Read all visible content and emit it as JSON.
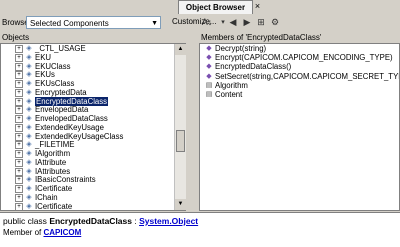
{
  "tab": {
    "title": "Object Browser",
    "close_glyph": "×"
  },
  "toolbar": {
    "browse_label": "Browse:",
    "browse_value": "Selected Components",
    "customize_label": "Customize...",
    "icons": [
      "sort-icon",
      "back-icon",
      "forward-icon",
      "add-reference-icon",
      "settings-icon"
    ]
  },
  "left_pane": {
    "header": "Objects",
    "items": [
      {
        "label": "_CTL_USAGE"
      },
      {
        "label": "EKU"
      },
      {
        "label": "EKUClass"
      },
      {
        "label": "EKUs"
      },
      {
        "label": "EKUsClass"
      },
      {
        "label": "EncryptedData"
      },
      {
        "label": "EncryptedDataClass",
        "selected": true
      },
      {
        "label": "EnvelopedData"
      },
      {
        "label": "EnvelopedDataClass"
      },
      {
        "label": "ExtendedKeyUsage"
      },
      {
        "label": "ExtendedKeyUsageClass"
      },
      {
        "label": "_FILETIME"
      },
      {
        "label": "IAlgorithm"
      },
      {
        "label": "IAttribute"
      },
      {
        "label": "IAttributes"
      },
      {
        "label": "IBasicConstraints"
      },
      {
        "label": "ICertificate"
      },
      {
        "label": "IChain"
      },
      {
        "label": "ICertificate"
      }
    ]
  },
  "right_pane": {
    "header": "Members of 'EncryptedDataClass'",
    "items": [
      {
        "label": "Decrypt(string)",
        "kind": "method"
      },
      {
        "label": "Encrypt(CAPICOM.CAPICOM_ENCODING_TYPE)",
        "kind": "method"
      },
      {
        "label": "EncryptedDataClass()",
        "kind": "method"
      },
      {
        "label": "SetSecret(string,CAPICOM.CAPICOM_SECRET_TYPE)",
        "kind": "method"
      },
      {
        "label": "Algorithm",
        "kind": "property"
      },
      {
        "label": "Content",
        "kind": "property"
      }
    ]
  },
  "description": {
    "prefix": "public class ",
    "class_name": "EncryptedDataClass",
    "separator": " : ",
    "base_link": "System.Object",
    "member_of_label": "Member of ",
    "namespace_link": "CAPICOM"
  }
}
